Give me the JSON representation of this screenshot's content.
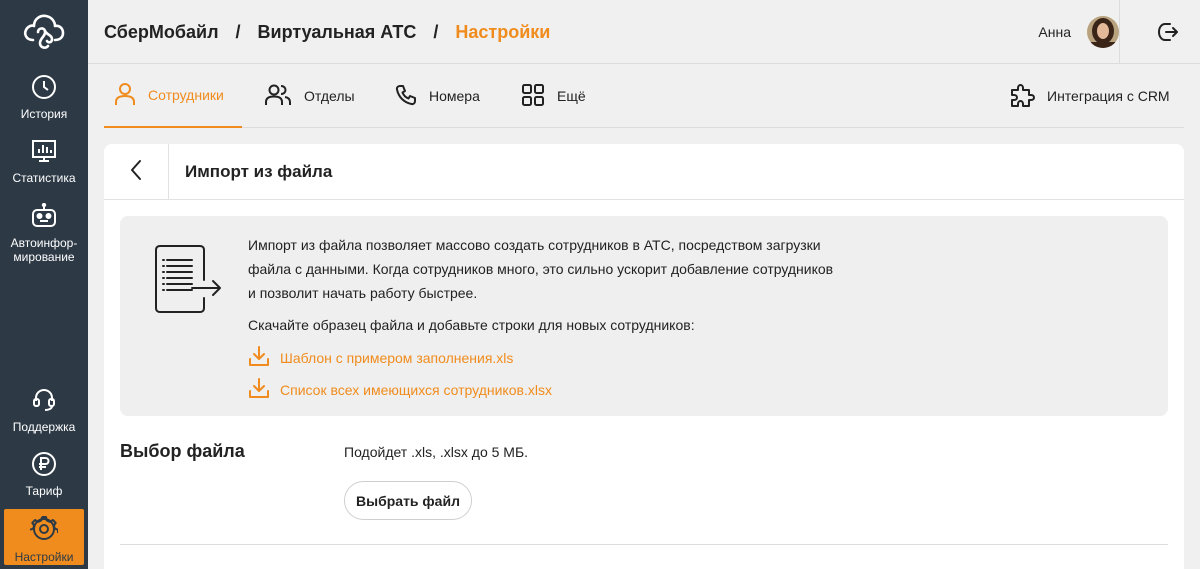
{
  "sidebar": {
    "items": [
      {
        "label": "История",
        "icon": "clock-icon"
      },
      {
        "label": "Статистика",
        "icon": "chart-monitor-icon"
      },
      {
        "label": "Автоинфор-мирование",
        "line1": "Автоинфор-",
        "line2": "мирование",
        "icon": "robot-icon"
      },
      {
        "label": "Поддержка",
        "icon": "headset-icon"
      },
      {
        "label": "Тариф",
        "icon": "ruble-icon"
      },
      {
        "label": "Настройки",
        "icon": "gear-icon",
        "active": true
      }
    ]
  },
  "breadcrumb": {
    "items": [
      "СберМобайл",
      "Виртуальная АТС",
      "Настройки"
    ],
    "separator": "/"
  },
  "user": {
    "name": "Анна"
  },
  "tabs": [
    {
      "label": "Сотрудники",
      "icon": "person-icon",
      "active": true
    },
    {
      "label": "Отделы",
      "icon": "people-icon"
    },
    {
      "label": "Номера",
      "icon": "phone-icon"
    },
    {
      "label": "Ещё",
      "icon": "grid-icon"
    },
    {
      "label": "Интеграция с CRM",
      "icon": "puzzle-icon"
    }
  ],
  "card": {
    "title": "Импорт из файла",
    "info": {
      "line1": "Импорт из файла позволяет массово создать сотрудников в АТС, посредством загрузки",
      "line2": "файла с данными. Когда сотрудников много, это сильно ускорит добавление сотрудников",
      "line3": "и позволит начать работу быстрее.",
      "hint": "Скачайте образец файла и добавьте строки для новых сотрудников:",
      "links": [
        "Шаблон с примером заполнения.xls",
        "Список всех имеющихся сотрудников.xlsx"
      ]
    },
    "file_section": {
      "title": "Выбор файла",
      "hint": "Подойдет .xls, .xlsx до 5 МБ.",
      "button": "Выбрать файл"
    }
  },
  "colors": {
    "accent": "#f08c1d",
    "sidebar_bg": "#2d3a46",
    "page_bg": "#f0f0f0"
  }
}
